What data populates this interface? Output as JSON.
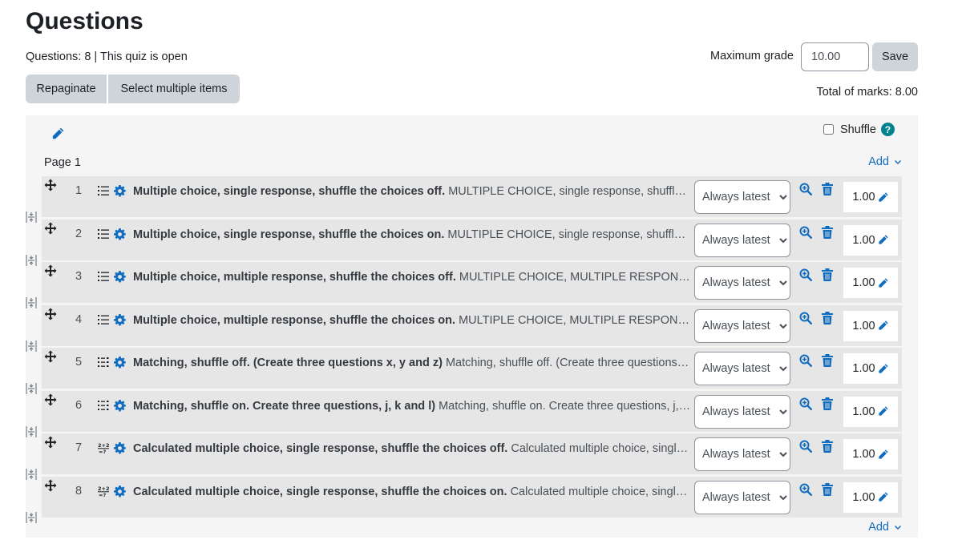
{
  "page": {
    "title": "Questions",
    "status": "Questions: 8 | This quiz is open"
  },
  "toolbar": {
    "repaginate_label": "Repaginate",
    "select_multiple_label": "Select multiple items",
    "max_grade_label": "Maximum grade",
    "max_grade_value": "10.00",
    "save_label": "Save",
    "total_marks": "Total of marks: 8.00"
  },
  "section": {
    "shuffle_label": "Shuffle",
    "shuffle_checked": false,
    "help_symbol": "?",
    "page_label": "Page 1",
    "add_label": "Add"
  },
  "questions": [
    {
      "number": "1",
      "icon": "multichoice-list-icon",
      "title": "Multiple choice, single response, shuffle the choices off.",
      "summary": "MULTIPLE CHOICE, single response, shuffle the choices off.",
      "version": "Always latest",
      "mark": "1.00"
    },
    {
      "number": "2",
      "icon": "multichoice-list-icon",
      "title": "Multiple choice, single response, shuffle the choices on.",
      "summary": "MULTIPLE CHOICE, single response, shuffle the choices on.",
      "version": "Always latest",
      "mark": "1.00"
    },
    {
      "number": "3",
      "icon": "multichoice-list-icon",
      "title": "Multiple choice, multiple response, shuffle the choices off.",
      "summary": "MULTIPLE CHOICE, MULTIPLE RESPONSE, shuffle the choices off.",
      "version": "Always latest",
      "mark": "1.00"
    },
    {
      "number": "4",
      "icon": "multichoice-list-icon",
      "title": "Multiple choice, multiple response, shuffle the choices on.",
      "summary": "MULTIPLE CHOICE, MULTIPLE RESPONSE, shuffle the choices on.",
      "version": "Always latest",
      "mark": "1.00"
    },
    {
      "number": "5",
      "icon": "matching-icon",
      "title": "Matching, shuffle off. (Create three questions x, y and z)",
      "summary": "Matching, shuffle off. (Create three questions x, y and z)",
      "version": "Always latest",
      "mark": "1.00"
    },
    {
      "number": "6",
      "icon": "matching-icon",
      "title": "Matching, shuffle on. Create three questions, j, k and l)",
      "summary": "Matching, shuffle on. Create three questions, j, k and l)",
      "version": "Always latest",
      "mark": "1.00"
    },
    {
      "number": "7",
      "icon": "calculated-icon",
      "title": "Calculated multiple choice, single response, shuffle the choices off.",
      "summary": "Calculated multiple choice, single response, shuffle the choices off.",
      "version": "Always latest",
      "mark": "1.00"
    },
    {
      "number": "8",
      "icon": "calculated-icon",
      "title": "Calculated multiple choice, single response, shuffle the choices on.",
      "summary": "Calculated multiple choice, single response, shuffle the choices on.",
      "version": "Always latest",
      "mark": "1.00"
    }
  ],
  "colors": {
    "link": "#0f6cbf",
    "help": "#00838f",
    "button_grey": "#ced4da",
    "slot_bg": "#e6e6e6",
    "panel_bg": "#f5f5f5"
  }
}
